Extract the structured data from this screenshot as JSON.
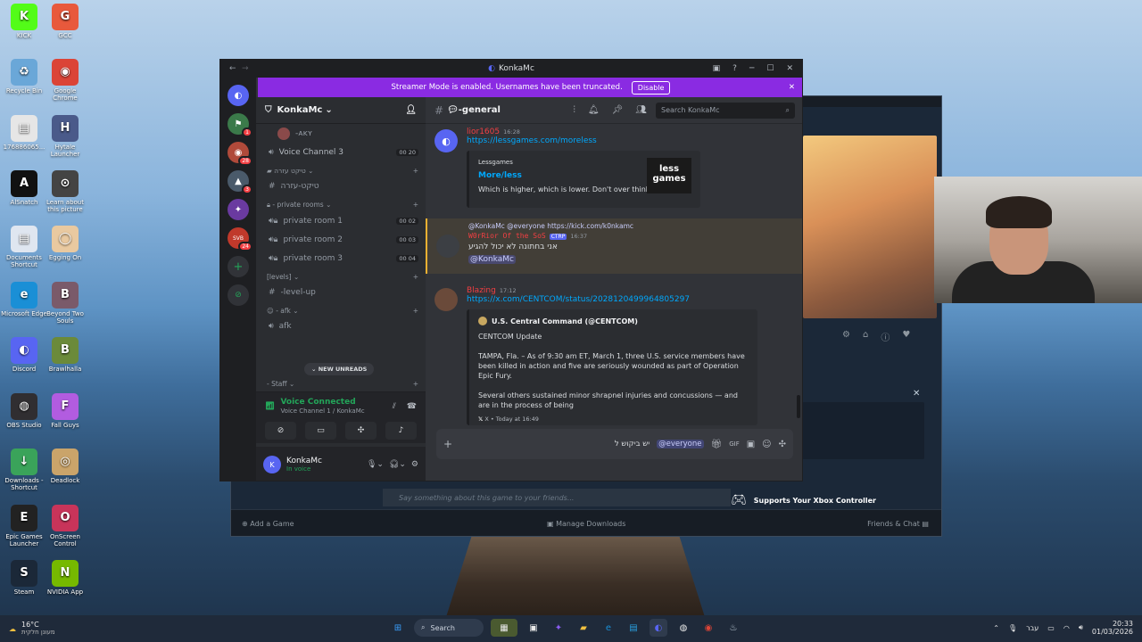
{
  "desktop_icons": [
    {
      "label": "KICK",
      "color": "#53fc18",
      "glyph": "K"
    },
    {
      "label": "GCC",
      "color": "#e8593c",
      "glyph": "G"
    },
    {
      "label": "Recycle Bin",
      "color": "#6aa7d8",
      "glyph": "♻"
    },
    {
      "label": "Google Chrome",
      "color": "#db4437",
      "glyph": "◉"
    },
    {
      "label": "176886065...",
      "color": "#e6e6e6",
      "glyph": "▤"
    },
    {
      "label": "Hytale Launcher",
      "color": "#4a5a8a",
      "glyph": "H"
    },
    {
      "label": "AlSnatch",
      "color": "#111111",
      "glyph": "A"
    },
    {
      "label": "Learn about this picture",
      "color": "#444444",
      "glyph": "⊙"
    },
    {
      "label": "Documents Shortcut",
      "color": "#dfe6f0",
      "glyph": "▤"
    },
    {
      "label": "Egging On",
      "color": "#e9c9a0",
      "glyph": "◯"
    },
    {
      "label": "Microsoft Edge",
      "color": "#1a8fd6",
      "glyph": "e"
    },
    {
      "label": "Beyond Two Souls",
      "color": "#7a5a6a",
      "glyph": "B"
    },
    {
      "label": "Discord",
      "color": "#5865f2",
      "glyph": "◐"
    },
    {
      "label": "Brawlhalla",
      "color": "#6b8a3a",
      "glyph": "B"
    },
    {
      "label": "OBS Studio",
      "color": "#302e31",
      "glyph": "◍"
    },
    {
      "label": "Fall Guys",
      "color": "#b25ce0",
      "glyph": "F"
    },
    {
      "label": "Downloads - Shortcut",
      "color": "#3aa35a",
      "glyph": "↓"
    },
    {
      "label": "Deadlock",
      "color": "#caa46a",
      "glyph": "◎"
    },
    {
      "label": "Epic Games Launcher",
      "color": "#222222",
      "glyph": "E"
    },
    {
      "label": "OnScreen Control",
      "color": "#c8345a",
      "glyph": "O"
    },
    {
      "label": "Steam",
      "color": "#1b2838",
      "glyph": "S"
    },
    {
      "label": "NVIDIA App",
      "color": "#76b900",
      "glyph": "N"
    }
  ],
  "steam": {
    "controller_text": "Supports Your Xbox Controller",
    "comment_placeholder": "Say something about this game to your friends...",
    "add_game": "Add a Game",
    "manage_downloads": "Manage Downloads",
    "friends_chat": "Friends & Chat"
  },
  "discord": {
    "window_title": "KonkaMc",
    "banner_text": "Streamer Mode is enabled. Usernames have been truncated.",
    "banner_button": "Disable",
    "server_name": "KonkaMc",
    "servers": [
      {
        "color": "#5865f2",
        "glyph": "◐",
        "badge": ""
      },
      {
        "color": "#3b7a4a",
        "glyph": "⚑",
        "badge": "1"
      },
      {
        "color": "#b04a3a",
        "glyph": "◉",
        "badge": "28"
      },
      {
        "color": "#4a5a6a",
        "glyph": "▲",
        "badge": "3"
      },
      {
        "color": "#6a3aa0",
        "glyph": "✦",
        "badge": ""
      },
      {
        "color": "#c0392b",
        "glyph": "SVB",
        "badge": "24"
      }
    ],
    "channels": [
      {
        "type": "text",
        "name": "-ᴀᴋʏ",
        "count": "",
        "id": "akz"
      },
      {
        "type": "voice",
        "name": "Voice Channel 3",
        "count": "00 20",
        "id": "vc3"
      }
    ],
    "category1": "טיקט עזרה",
    "channel_ticket": "טיקט-עזרה",
    "category_private": "private rooms",
    "private_rooms": [
      {
        "name": "private room 1",
        "count": "00 02"
      },
      {
        "name": "private room 2",
        "count": "00 03"
      },
      {
        "name": "private room 3",
        "count": "00 04"
      }
    ],
    "category_levels": "[levels]",
    "channel_levelup": "-level-up",
    "category_afk": "afk",
    "channel_afk": "afk",
    "new_unreads": "NEW UNREADS",
    "category_staff": "Staff",
    "voice_connected": "Voice Connected",
    "voice_sub": "Voice Channel 1 / KonkaMc",
    "user_name": "KonkaMc",
    "user_status": "In voice",
    "channel_header": "-general",
    "search_placeholder": "Search KonkaMc",
    "messages": {
      "m1": {
        "author": "lior1605",
        "time": "16:28",
        "link": "https://lessgames.com/moreless",
        "embed_site": "Lessgames",
        "embed_title": "More/less",
        "embed_desc": "Which is higher, which is lower. Don't over think it.",
        "thumb": "less games"
      },
      "m2": {
        "reply": "@KonkaMc @everyone https://kick.com/k0nkamc",
        "author": "W0rRior Of the SoS",
        "tag": "CTRP",
        "time": "16:37",
        "text": "אני בחתונה לא יכול להגיע",
        "mention": "@KonkaMc"
      },
      "m3": {
        "author": "Blazing",
        "time": "17:12",
        "link": "https://x.com/CENTCOM/status/2028120499964805297",
        "embed_author": "U.S. Central Command (@CENTCOM)",
        "line1": "CENTCOM Update",
        "line2": "TAMPA, Fla. – As of 9:30 am ET, March 1, three U.S. service members have been killed in action and five are seriously wounded as part of Operation Epic Fury.",
        "line3": "Several others sustained minor shrapnel injuries and concussions — and are in the process of being",
        "footer": "X • Today at 16:49"
      }
    },
    "composer_text": "יש ביקוש ל",
    "composer_mention": "@everyone"
  },
  "taskbar": {
    "weather_temp": "16°C",
    "weather_desc": "מעונן חלקית",
    "search": "Search",
    "lang": "עבר",
    "time": "20:33",
    "date": "01/03/2026"
  }
}
